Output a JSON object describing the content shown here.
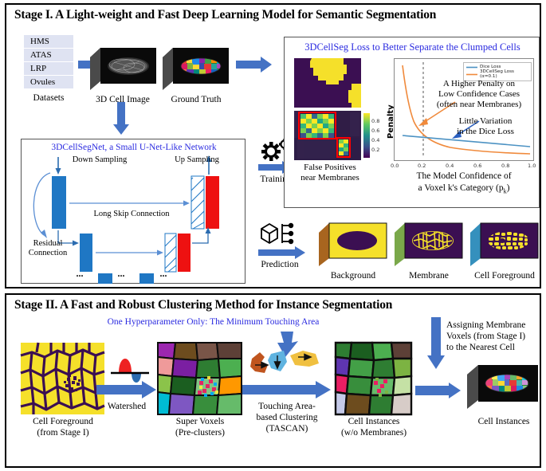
{
  "stage1": {
    "title": "Stage I. A Light-weight and Fast Deep Learning Model for Semantic Segmentation",
    "datasets": {
      "items": [
        "HMS",
        "ATAS",
        "LRP",
        "Ovules"
      ],
      "caption": "Datasets"
    },
    "volumes": {
      "cell_image": "3D Cell Image",
      "ground_truth": "Ground Truth"
    },
    "network": {
      "title": "3DCellSegNet, a Small U-Net-Like Network",
      "down_sampling": "Down Sampling",
      "up_sampling": "Up Sampling",
      "long_skip": "Long Skip Connection",
      "residual": "Residual\nConnection",
      "residual_line1": "Residual",
      "residual_line2": "Connection",
      "ellipsis": "..."
    },
    "flow": {
      "training": "Training",
      "prediction": "Prediction"
    },
    "loss_panel": {
      "title": "3DCellSeg Loss to Better Separate the Clumped Cells",
      "fp_caption_line1": "False Positives",
      "fp_caption_line2": "near Membranes",
      "colorbar_ticks": [
        "0.8",
        "0.6",
        "0.4",
        "0.2"
      ],
      "annotation_high_penalty": "A Higher Penalty on\nLow Confidence Cases\n(often near Membranes)",
      "ann_hp_l1": "A Higher Penalty on",
      "ann_hp_l2": "Low Confidence Cases",
      "ann_hp_l3": "(often near Membranes)",
      "ann_lv_l1": "Little Variation",
      "ann_lv_l2": "in the Dice Loss"
    },
    "outputs": [
      {
        "label": "Background"
      },
      {
        "label": "Membrane"
      },
      {
        "label": "Cell Foreground"
      }
    ]
  },
  "stage2": {
    "title": "Stage II. A Fast and Robust Clustering Method for Instance Segmentation",
    "subtitle": "One Hyperparameter Only: The Minimum Touching Area",
    "panels": [
      {
        "label_line1": "Cell Foreground",
        "label_line2": "(from Stage I)"
      },
      {
        "label_line1": "Super Voxels",
        "label_line2": "(Pre-clusters)"
      },
      {
        "label_line1": "Cell Instances",
        "label_line2": "(w/o Membranes)"
      },
      {
        "label_line1": "Cell Instances",
        "label_line2": ""
      }
    ],
    "ops": {
      "watershed": "Watershed",
      "tascan_l1": "Touching Area-",
      "tascan_l2": "based Clustering",
      "tascan_l3": "(TASCAN)",
      "assign_l1": "Assigning Membrane",
      "assign_l2": "Voxels (from Stage I)",
      "assign_l3": "to the Nearest Cell"
    }
  },
  "chart_data": {
    "type": "line",
    "title": "",
    "xlabel_line1": "The Model Confidence of",
    "xlabel_line2": "a Voxel k's Category (p",
    "xlabel_sub": "k",
    "xlabel_end": ")",
    "ylabel": "Penalty",
    "xlim": [
      0.0,
      1.0
    ],
    "ylim": [
      0.0,
      1.0
    ],
    "xticks": [
      "0.0",
      "0.2",
      "0.4",
      "0.6",
      "0.8",
      "1.0"
    ],
    "yticks": [],
    "grid": false,
    "vline_x": 0.18,
    "legend_position": "upper right",
    "legend": [
      "Dice Loss",
      "3DCellSeg Loss (α=0.1)"
    ],
    "colors": {
      "dice": "#4c92c3",
      "cellseg": "#f08a3c"
    },
    "series": [
      {
        "name": "Dice Loss",
        "color": "#4c92c3",
        "x": [
          0.0,
          0.1,
          0.2,
          0.3,
          0.4,
          0.5,
          0.6,
          0.7,
          0.8,
          0.9,
          1.0
        ],
        "values": [
          0.3,
          0.285,
          0.27,
          0.255,
          0.24,
          0.225,
          0.21,
          0.195,
          0.18,
          0.165,
          0.15
        ]
      },
      {
        "name": "3DCellSeg Loss (α=0.1)",
        "color": "#f08a3c",
        "x": [
          0.02,
          0.05,
          0.1,
          0.15,
          0.2,
          0.25,
          0.3,
          0.4,
          0.5,
          0.6,
          0.7,
          0.8,
          0.9,
          1.0
        ],
        "values": [
          0.97,
          0.8,
          0.56,
          0.4,
          0.29,
          0.23,
          0.185,
          0.14,
          0.115,
          0.1,
          0.09,
          0.085,
          0.08,
          0.078
        ]
      }
    ]
  },
  "colors": {
    "arrow_blue": "#4472c4",
    "title_blue": "#2b2be0",
    "net_blue": "#1f77c4",
    "net_red": "#ee1111",
    "viridis_dark": "#3b0f52",
    "viridis_yellow": "#f5e02a"
  }
}
